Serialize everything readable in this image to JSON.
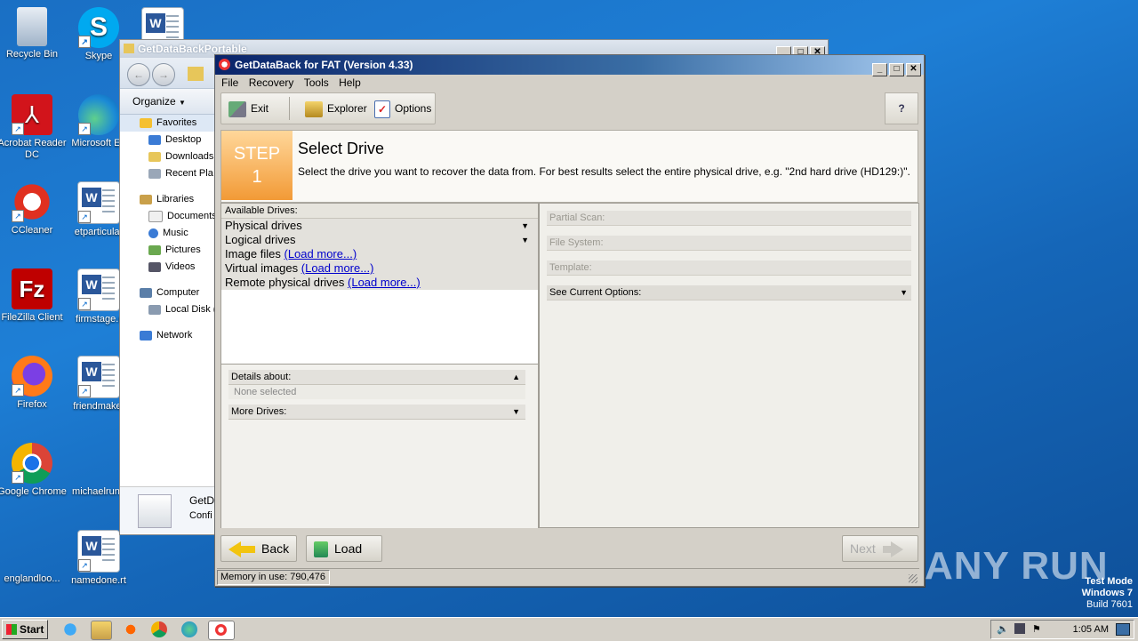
{
  "desktop": {
    "icons": [
      {
        "label": "Recycle Bin",
        "icon": "recycle-bin-icon"
      },
      {
        "label": "Skype",
        "icon": "skype-icon"
      },
      {
        "label": "Acrobat Reader DC",
        "icon": "acrobat-icon"
      },
      {
        "label": "Microsoft Ed",
        "icon": "edge-icon"
      },
      {
        "label": "CCleaner",
        "icon": "ccleaner-icon"
      },
      {
        "label": "etparticular",
        "icon": "word-doc-icon"
      },
      {
        "label": "FileZilla Client",
        "icon": "filezilla-icon"
      },
      {
        "label": "firmstage.r",
        "icon": "word-doc-icon"
      },
      {
        "label": "Firefox",
        "icon": "firefox-icon"
      },
      {
        "label": "friendmake.",
        "icon": "word-doc-icon"
      },
      {
        "label": "Google Chrome",
        "icon": "chrome-icon"
      },
      {
        "label": "michaelrunn",
        "icon": "word-doc-icon"
      },
      {
        "label": "englandloo...",
        "icon": "file-icon"
      },
      {
        "label": "namedone.rt",
        "icon": "word-doc-icon"
      }
    ]
  },
  "explorer": {
    "title": "GetDataBackPortable",
    "organize": "Organize",
    "nav": {
      "favorites": "Favorites",
      "desktop": "Desktop",
      "downloads": "Downloads",
      "recent": "Recent Pla",
      "libraries": "Libraries",
      "documents": "Documents",
      "music": "Music",
      "pictures": "Pictures",
      "videos": "Videos",
      "computer": "Computer",
      "localdisk": "Local Disk (",
      "network": "Network"
    },
    "details_name": "GetD",
    "details_type": "Confi"
  },
  "app": {
    "title": "GetDataBack for FAT (Version 4.33)",
    "menu": [
      "File",
      "Recovery",
      "Tools",
      "Help"
    ],
    "toolbar": {
      "exit": "Exit",
      "explorer": "Explorer",
      "options": "Options"
    },
    "step": {
      "label": "STEP",
      "number": "1",
      "title": "Select Drive",
      "description": "Select the drive you want to recover the data from. For best results select the entire physical drive, e.g. \"2nd hard drive (HD129:)\"."
    },
    "available_drives": {
      "header": "Available Drives:",
      "physical": "Physical drives",
      "logical": "Logical drives",
      "image": "Image files",
      "virtual": "Virtual images",
      "remote": "Remote physical drives",
      "load_more": "(Load more...)"
    },
    "details": {
      "header": "Details about:",
      "value": "None selected",
      "more": "More Drives:"
    },
    "options": {
      "partial_scan": "Partial Scan:",
      "file_system": "File System:",
      "template": "Template:",
      "current_options": "See Current Options:"
    },
    "buttons": {
      "back": "Back",
      "load": "Load",
      "next": "Next"
    },
    "status": "Memory in use: 790,476"
  },
  "watermark": {
    "brand": "ANY RUN",
    "line1": "Test Mode",
    "line2": "Windows 7",
    "line3": "Build 7601"
  },
  "taskbar": {
    "start": "Start",
    "clock": "1:05 AM"
  }
}
